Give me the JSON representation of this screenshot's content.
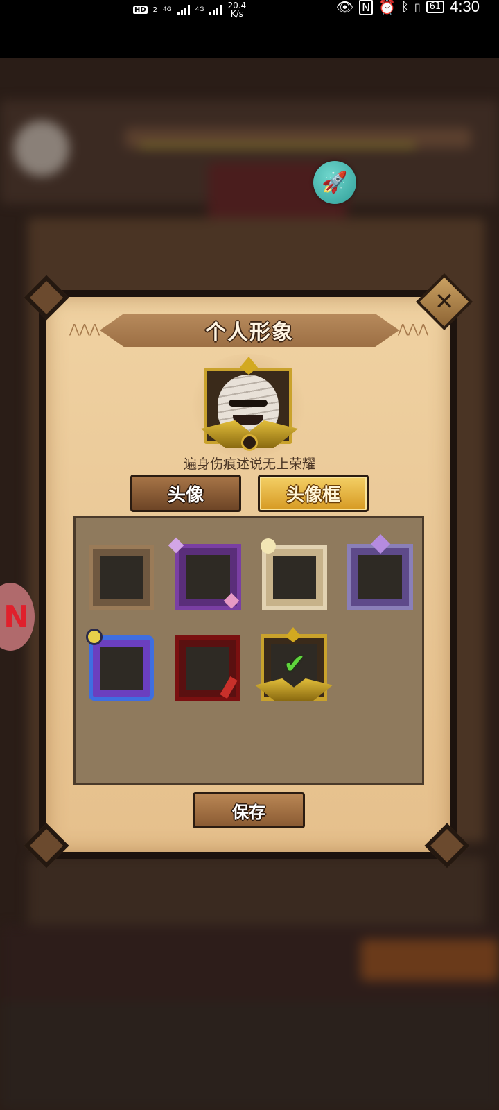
{
  "status_bar": {
    "hd_badge": "HD",
    "sim_slot": "2",
    "net_1": "4G",
    "net_2": "4G",
    "net_speed": "20.4",
    "net_speed_unit": "K/s",
    "battery": "61",
    "time": "4:30"
  },
  "dialog": {
    "title": "个人形象",
    "close_label": "✕",
    "subtitle": "遍身伤痕述说无上荣耀",
    "tabs": [
      {
        "label": "头像",
        "selected": false
      },
      {
        "label": "头像框",
        "selected": true
      }
    ],
    "frames": [
      {
        "icon": "basic-wood-frame-icon",
        "selected": false
      },
      {
        "icon": "purple-gem-frame-icon",
        "selected": false
      },
      {
        "icon": "silver-planet-frame-icon",
        "selected": false
      },
      {
        "icon": "crystal-crown-frame-icon",
        "selected": false
      },
      {
        "icon": "moon-cosmic-frame-icon",
        "selected": false
      },
      {
        "icon": "red-dagger-frame-icon",
        "selected": false
      },
      {
        "icon": "golden-winged-frame-icon",
        "selected": true
      }
    ],
    "save_label": "保存"
  },
  "floating": {
    "rocket_icon": "rocket-icon",
    "left_icon": "game-logo-icon"
  },
  "colors": {
    "selected_tab": "#e6b23b",
    "check": "#5fd43c",
    "rocket_bubble": "#43aea6"
  }
}
